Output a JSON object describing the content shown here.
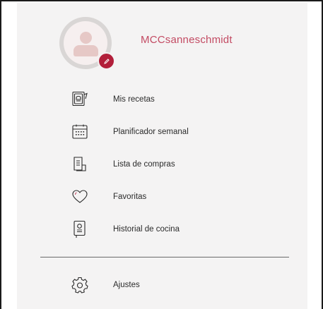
{
  "profile": {
    "username": "MCCsanneschmidt",
    "avatar_icon": "user-placeholder-icon",
    "edit_icon": "pencil-icon",
    "accent_color": "#b21f3a",
    "username_color": "#c34b63"
  },
  "menu": {
    "items": [
      {
        "label": "Mis recetas",
        "icon": "recipe-book-icon"
      },
      {
        "label": "Planificador semanal",
        "icon": "calendar-icon"
      },
      {
        "label": "Lista de compras",
        "icon": "shopping-list-icon"
      },
      {
        "label": "Favoritas",
        "icon": "heart-icon"
      },
      {
        "label": "Historial de cocina",
        "icon": "cooking-history-icon"
      }
    ],
    "settings": {
      "label": "Ajustes",
      "icon": "gear-icon"
    }
  }
}
